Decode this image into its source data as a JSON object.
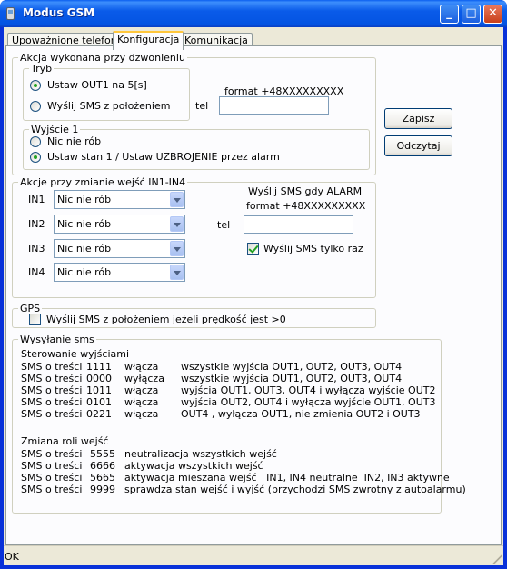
{
  "window": {
    "title": "Modus GSM"
  },
  "titlebar_buttons": {
    "minimize": "_",
    "maximize": "□",
    "close": "✕"
  },
  "tabs": [
    {
      "label": "Upoważnione telefony",
      "active": false
    },
    {
      "label": "Konfiguracja",
      "active": true
    },
    {
      "label": "Komunikacja",
      "active": false
    }
  ],
  "call_action": {
    "legend": "Akcja wykonana przy dzwonieniu",
    "mode": {
      "legend": "Tryb",
      "options": [
        {
          "label": "Ustaw  OUT1 na 5[s]",
          "checked": true
        },
        {
          "label": "Wyślij SMS z położeniem",
          "checked": false
        }
      ]
    },
    "format_label": "format +48XXXXXXXXX",
    "tel_label": "tel",
    "tel_value": "",
    "output": {
      "legend": "Wyjście 1",
      "options": [
        {
          "label": "Nic nie rób",
          "checked": false
        },
        {
          "label": "Ustaw stan 1 /  Ustaw UZBROJENIE przez alarm",
          "checked": true
        }
      ]
    }
  },
  "buttons": {
    "save": "Zapisz",
    "read": "Odczytaj"
  },
  "input_changes": {
    "legend": "Akcje przy zmianie wejść IN1-IN4",
    "inputs": [
      {
        "label": "IN1",
        "value": "Nic nie rób"
      },
      {
        "label": "IN2",
        "value": "Nic nie rób"
      },
      {
        "label": "IN3",
        "value": "Nic nie rób"
      },
      {
        "label": "IN4",
        "value": "Nic nie rób"
      }
    ],
    "alarm_sms_label": "Wyślij SMS gdy ALARM",
    "format_label": "format +48XXXXXXXXX",
    "tel_label": "tel",
    "tel_value": "",
    "once_label": "Wyślij SMS tylko raz",
    "once_checked": true
  },
  "gps": {
    "legend": "GPS",
    "speed_label": "Wyślij SMS z położeniem jeżeli prędkość jest >0",
    "speed_checked": false
  },
  "sms": {
    "legend": "Wysyłanie sms",
    "outputs_heading": "Sterowanie wyjściami",
    "outputs": [
      {
        "prefix": "SMS o treści",
        "code": "1111",
        "action": "włącza",
        "desc": "wszystkie wyjścia OUT1, OUT2, OUT3, OUT4"
      },
      {
        "prefix": "SMS o treści",
        "code": "0000",
        "action": "wyłącza",
        "desc": "wszystkie wyjścia OUT1, OUT2, OUT3, OUT4"
      },
      {
        "prefix": "SMS o treści",
        "code": "1011",
        "action": "włącza",
        "desc": "wyjścia OUT1, OUT3, OUT4 i wyłącza wyjście OUT2"
      },
      {
        "prefix": "SMS o treści",
        "code": "0101",
        "action": "włącza",
        "desc": "wyjścia OUT2, OUT4 i wyłącza wyjście OUT1, OUT3"
      },
      {
        "prefix": "SMS o treści",
        "code": "0221",
        "action": "włącza",
        "desc": "OUT4 , wyłącza OUT1, nie zmienia OUT2 i OUT3"
      }
    ],
    "roles_heading": "Zmiana roli wejść",
    "roles": [
      {
        "prefix": "SMS o treści",
        "code": "5555",
        "desc": "neutralizacja wszystkich wejść"
      },
      {
        "prefix": "SMS o treści",
        "code": "6666",
        "desc": "aktywacja wszystkich wejść"
      },
      {
        "prefix": "SMS o treści",
        "code": "5665",
        "desc": "aktywacja mieszana wejść   IN1, IN4 neutralne  IN2, IN3 aktywne"
      },
      {
        "prefix": "SMS o treści",
        "code": "9999",
        "desc": "sprawdza stan wejść i wyjść (przychodzi SMS zwrotny z autoalarmu)"
      }
    ]
  },
  "status": {
    "text": "OK"
  }
}
